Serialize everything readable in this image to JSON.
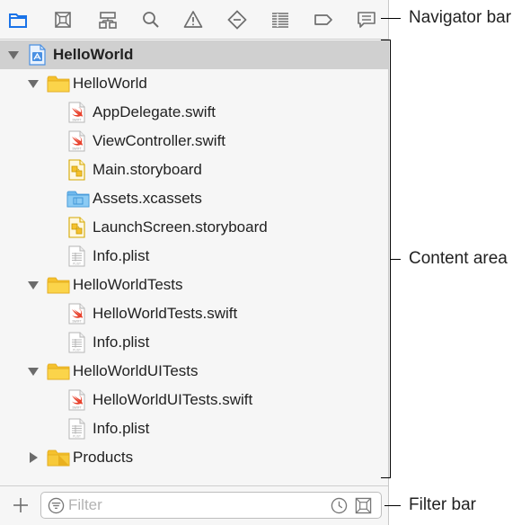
{
  "navigator_bar": {
    "icons": [
      {
        "name": "project-navigator-icon",
        "active": true
      },
      {
        "name": "source-control-navigator-icon",
        "active": false
      },
      {
        "name": "symbol-navigator-icon",
        "active": false
      },
      {
        "name": "find-navigator-icon",
        "active": false
      },
      {
        "name": "issue-navigator-icon",
        "active": false
      },
      {
        "name": "test-navigator-icon",
        "active": false
      },
      {
        "name": "debug-navigator-icon",
        "active": false
      },
      {
        "name": "breakpoint-navigator-icon",
        "active": false
      },
      {
        "name": "report-navigator-icon",
        "active": false
      }
    ],
    "active_color": "#1a73e8"
  },
  "tree": [
    {
      "label": "HelloWorld",
      "kind": "project",
      "depth": 0,
      "expanded": true,
      "selected": true
    },
    {
      "label": "HelloWorld",
      "kind": "folder",
      "depth": 1,
      "expanded": true
    },
    {
      "label": "AppDelegate.swift",
      "kind": "swift",
      "depth": 2
    },
    {
      "label": "ViewController.swift",
      "kind": "swift",
      "depth": 2
    },
    {
      "label": "Main.storyboard",
      "kind": "storyboard",
      "depth": 2
    },
    {
      "label": "Assets.xcassets",
      "kind": "assets",
      "depth": 2
    },
    {
      "label": "LaunchScreen.storyboard",
      "kind": "storyboard",
      "depth": 2
    },
    {
      "label": "Info.plist",
      "kind": "plist",
      "depth": 2
    },
    {
      "label": "HelloWorldTests",
      "kind": "folder",
      "depth": 1,
      "expanded": true
    },
    {
      "label": "HelloWorldTests.swift",
      "kind": "swift",
      "depth": 2
    },
    {
      "label": "Info.plist",
      "kind": "plist",
      "depth": 2
    },
    {
      "label": "HelloWorldUITests",
      "kind": "folder",
      "depth": 1,
      "expanded": true
    },
    {
      "label": "HelloWorldUITests.swift",
      "kind": "swift",
      "depth": 2
    },
    {
      "label": "Info.plist",
      "kind": "plist",
      "depth": 2
    },
    {
      "label": "Products",
      "kind": "folder",
      "depth": 1,
      "expanded": false
    }
  ],
  "filter_bar": {
    "placeholder": "Filter"
  },
  "callouts": {
    "navigator_bar": "Navigator bar",
    "content_area": "Content area",
    "filter_bar": "Filter bar"
  },
  "colors": {
    "folder": "#f5c12e",
    "selection": "#d0d0d0",
    "swift_accent": "#e8432e"
  }
}
